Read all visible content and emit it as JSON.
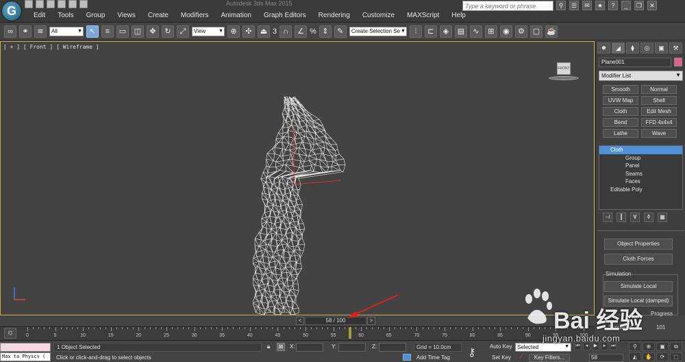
{
  "window": {
    "title": "Autodesk 3ds Max 2015",
    "search_placeholder": "Type a keyword or phrase"
  },
  "menubar": {
    "items": [
      "Edit",
      "Tools",
      "Group",
      "Views",
      "Create",
      "Modifiers",
      "Animation",
      "Graph Editors",
      "Rendering",
      "Customize",
      "MAXScript",
      "Help"
    ]
  },
  "main_toolbar": {
    "selection_filter": "All",
    "reference_coord": "View",
    "snap_label": "3",
    "angle_snap": "%",
    "named_selection_set": "Create Selection Se"
  },
  "viewport": {
    "label": "[ + ] [ Front ] [ Wireframe ]",
    "viewcube_label": "FRONT"
  },
  "command_panel": {
    "object_name": "Plane001",
    "object_color": "#e06090",
    "modifier_list_label": "Modifier List",
    "modifier_buttons": [
      "Smooth",
      "Normal",
      "UVW Map",
      "Shell",
      "Cloth",
      "Edit Mesh",
      "Bend",
      "FFD 4x4x4",
      "Lathe",
      "Wave"
    ],
    "stack": [
      {
        "label": "Cloth",
        "selected": true,
        "level": "root"
      },
      {
        "label": "Group",
        "selected": false,
        "level": "sub"
      },
      {
        "label": "Panel",
        "selected": false,
        "level": "sub"
      },
      {
        "label": "Seams",
        "selected": false,
        "level": "sub"
      },
      {
        "label": "Faces",
        "selected": false,
        "level": "sub"
      },
      {
        "label": "Editable Poly",
        "selected": false,
        "level": "root"
      }
    ],
    "object_properties": "Object Properties",
    "cloth_forces": "Cloth Forces",
    "simulation_group": "Simulation",
    "simulate_local": "Simulate Local",
    "simulate_local_damped": "Simulate Local (damped)",
    "progress_label": "Progress",
    "simulated_label": "Simulated",
    "simulated_value": "101"
  },
  "time_slider": {
    "current_frame": 58,
    "total_frames": 100,
    "display": "58 / 100"
  },
  "trackbar": {
    "ticks": [
      0,
      5,
      10,
      15,
      20,
      25,
      30,
      35,
      40,
      45,
      50,
      55,
      60,
      65,
      70,
      75,
      80,
      85,
      90,
      95,
      100
    ]
  },
  "statusbar": {
    "maxscript_text": "Max to Physcs (",
    "selection_status": "1 Object Selected",
    "prompt": "Click or click-and-drag to select objects",
    "x_label": "X:",
    "y_label": "Y:",
    "z_label": "Z:",
    "grid": "Grid = 10.0cm",
    "add_time_tag": "Add Time Tag",
    "auto_key": "Auto Key",
    "set_key": "Set Key",
    "key_mode": "Selected",
    "key_filters": "Key Filters...",
    "frame_field": "58"
  },
  "watermark": {
    "brand": "Bai 经验",
    "url": "jingyan.baidu.com"
  }
}
